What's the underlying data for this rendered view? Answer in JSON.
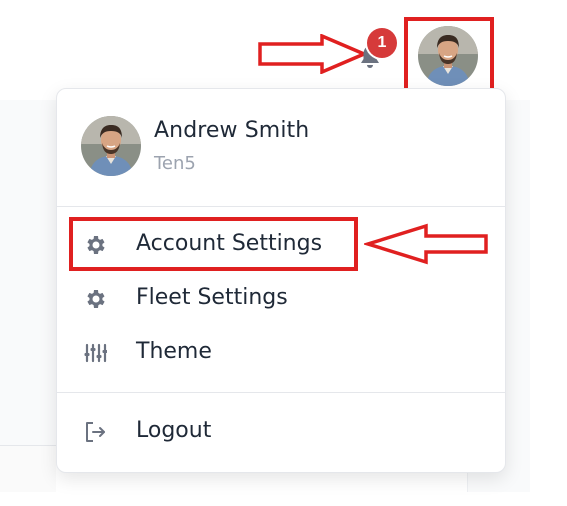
{
  "header": {
    "notification_count": "1",
    "bell_icon": "bell-icon",
    "avatar": "user-avatar"
  },
  "profile": {
    "name": "Andrew Smith",
    "organization": "Ten5"
  },
  "menu": {
    "items": [
      {
        "label": "Account Settings",
        "icon": "gear-icon"
      },
      {
        "label": "Fleet Settings",
        "icon": "gear-icon"
      },
      {
        "label": "Theme",
        "icon": "sliders-icon"
      },
      {
        "label": "Logout",
        "icon": "logout-icon"
      }
    ]
  },
  "colors": {
    "annotation_red": "#e02020",
    "badge_red": "#d63a3a",
    "text_dark": "#1f2937",
    "text_muted": "#9ca3af",
    "icon_gray": "#6b7280"
  }
}
